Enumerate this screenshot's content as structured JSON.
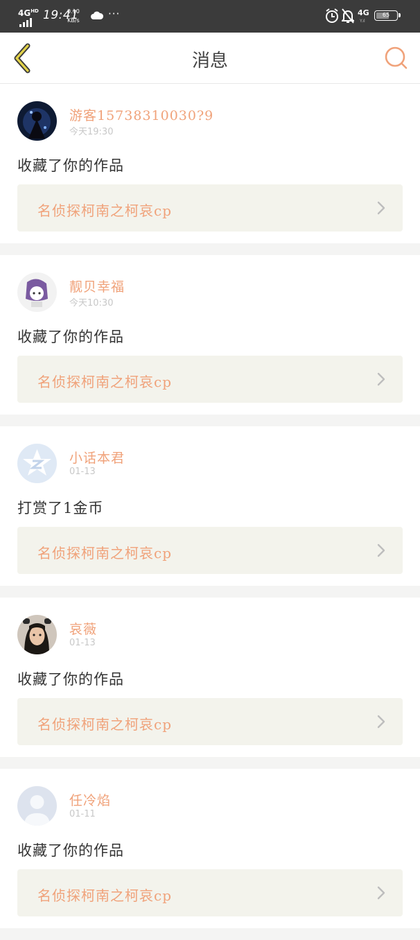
{
  "status_bar": {
    "network": "4G",
    "network_hd": "HD",
    "time": "19:41",
    "speed_value": "0.10",
    "speed_unit": "KB/s",
    "more": "···",
    "network2": "4G",
    "network2_sub": "Y.ıl",
    "battery": "65"
  },
  "nav": {
    "title": "消息",
    "back_icon": "chevron-left-icon",
    "search_icon": "search-icon"
  },
  "messages": [
    {
      "username": "游客15738310030?9",
      "time": "今天19:30",
      "action": "收藏了你的作品",
      "work_title": "名侦探柯南之柯哀cp",
      "avatar": "dark-character-avatar"
    },
    {
      "username": "靓贝幸福",
      "time": "今天10:30",
      "action": "收藏了你的作品",
      "work_title": "名侦探柯南之柯哀cp",
      "avatar": "anime-girl-avatar"
    },
    {
      "username": "小话本君",
      "time": "01-13",
      "action": "打赏了1金币",
      "work_title": "名侦探柯南之柯哀cp",
      "avatar": "qq-default-avatar"
    },
    {
      "username": "哀薇",
      "time": "01-13",
      "action": "收藏了你的作品",
      "work_title": "名侦探柯南之柯哀cp",
      "avatar": "girl-photo-avatar"
    },
    {
      "username": "任冷焰",
      "time": "01-11",
      "action": "收藏了你的作品",
      "work_title": "名侦探柯南之柯哀cp",
      "avatar": "default-person-avatar"
    }
  ],
  "colors": {
    "accent": "#f0a27a",
    "status_bar": "#3b3b3b",
    "card_box": "#f3f3ec",
    "divider": "#f4f4f3"
  }
}
